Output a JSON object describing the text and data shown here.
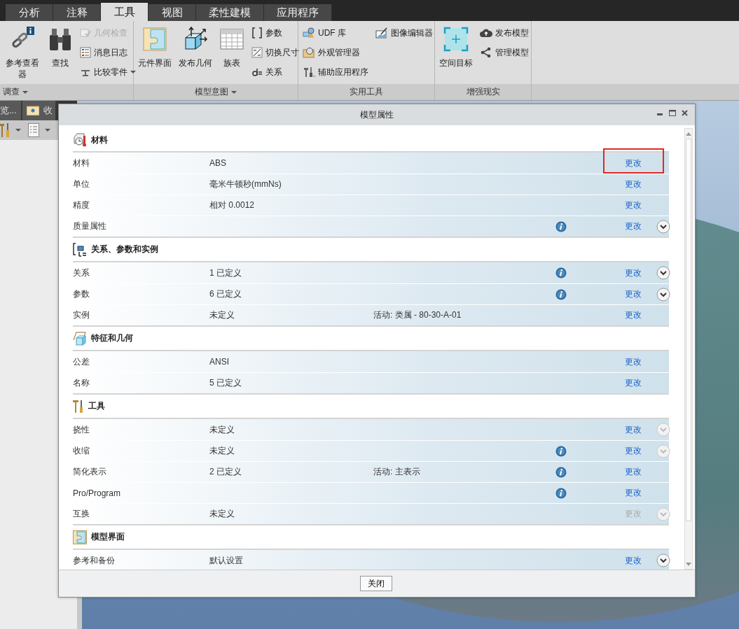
{
  "top_tabs": [
    {
      "label": "分析",
      "selected": false
    },
    {
      "label": "注释",
      "selected": false
    },
    {
      "label": "工具",
      "selected": true
    },
    {
      "label": "视图",
      "selected": false
    },
    {
      "label": "柔性建模",
      "selected": false
    },
    {
      "label": "应用程序",
      "selected": false
    }
  ],
  "ribbon": {
    "groups": [
      {
        "label": "调查",
        "dropdown": true,
        "items": [
          {
            "kind": "large",
            "label": "参考查看器",
            "disabled": false,
            "dropdown": false
          },
          {
            "kind": "large",
            "label": "查找",
            "disabled": false,
            "dropdown": false
          },
          {
            "kind": "small",
            "label": "几何检查",
            "disabled": true,
            "dropdown": false
          },
          {
            "kind": "small",
            "label": "消息日志",
            "disabled": false,
            "dropdown": false
          },
          {
            "kind": "small",
            "label": "比较零件",
            "disabled": false,
            "dropdown": true
          }
        ]
      },
      {
        "label": "模型意图",
        "dropdown": true,
        "items": [
          {
            "kind": "large",
            "label": "元件界面",
            "disabled": false,
            "dropdown": false
          },
          {
            "kind": "large",
            "label": "发布几何",
            "disabled": false,
            "dropdown": false
          },
          {
            "kind": "large",
            "label": "族表",
            "disabled": false,
            "dropdown": false
          },
          {
            "kind": "small",
            "label": "参数",
            "disabled": false,
            "dropdown": false
          },
          {
            "kind": "small",
            "label": "切换尺寸",
            "disabled": false,
            "dropdown": false
          },
          {
            "kind": "small",
            "label": "关系",
            "disabled": false,
            "dropdown": false
          }
        ]
      },
      {
        "label": "实用工具",
        "dropdown": false,
        "items": [
          {
            "kind": "small",
            "label": "UDF 库",
            "disabled": false,
            "dropdown": false
          },
          {
            "kind": "small",
            "label": "外观管理器",
            "disabled": false,
            "dropdown": false
          },
          {
            "kind": "small",
            "label": "辅助应用程序",
            "disabled": false,
            "dropdown": false
          },
          {
            "kind": "small",
            "label": "图像编辑器",
            "disabled": false,
            "dropdown": false
          }
        ]
      },
      {
        "label": "增强现实",
        "dropdown": false,
        "items": [
          {
            "kind": "large",
            "label": "空间目标",
            "disabled": false,
            "dropdown": false
          },
          {
            "kind": "small",
            "label": "发布模型",
            "disabled": false,
            "dropdown": false
          },
          {
            "kind": "small",
            "label": "管理模型",
            "disabled": false,
            "dropdown": false
          }
        ]
      }
    ]
  },
  "side_panel": {
    "tabs": [
      {
        "label": "览..."
      },
      {
        "label": "收"
      }
    ]
  },
  "dialog": {
    "title": "模型属性",
    "sections": [
      {
        "title": "材料",
        "rows": [
          {
            "label": "材料",
            "value": "ABS",
            "extra": "",
            "info": false,
            "link": "更改",
            "link_disabled": false,
            "expander": false,
            "highlighted": true
          },
          {
            "label": "单位",
            "value": "毫米牛顿秒(mmNs)",
            "extra": "",
            "info": false,
            "link": "更改",
            "link_disabled": false,
            "expander": false,
            "highlighted": false
          },
          {
            "label": "精度",
            "value": "相对 0.0012",
            "extra": "",
            "info": false,
            "link": "更改",
            "link_disabled": false,
            "expander": false,
            "highlighted": false
          },
          {
            "label": "质量属性",
            "value": "",
            "extra": "",
            "info": true,
            "link": "更改",
            "link_disabled": false,
            "expander": true,
            "expander_disabled": false,
            "highlighted": false
          }
        ]
      },
      {
        "title": "关系、参数和实例",
        "rows": [
          {
            "label": "关系",
            "value": "1 已定义",
            "extra": "",
            "info": true,
            "link": "更改",
            "link_disabled": false,
            "expander": true,
            "expander_disabled": false,
            "highlighted": false
          },
          {
            "label": "参数",
            "value": "6 已定义",
            "extra": "",
            "info": true,
            "link": "更改",
            "link_disabled": false,
            "expander": true,
            "expander_disabled": false,
            "highlighted": false
          },
          {
            "label": "实例",
            "value": "未定义",
            "extra": "活动: 类属 - 80-30-A-01",
            "info": false,
            "link": "更改",
            "link_disabled": false,
            "expander": false,
            "highlighted": false
          }
        ]
      },
      {
        "title": "特征和几何",
        "rows": [
          {
            "label": "公差",
            "value": "ANSI",
            "extra": "",
            "info": false,
            "link": "更改",
            "link_disabled": false,
            "expander": false,
            "highlighted": false
          },
          {
            "label": "名称",
            "value": "5 已定义",
            "extra": "",
            "info": false,
            "link": "更改",
            "link_disabled": false,
            "expander": false,
            "highlighted": false
          }
        ]
      },
      {
        "title": "工具",
        "rows": [
          {
            "label": "挠性",
            "value": "未定义",
            "extra": "",
            "info": false,
            "link": "更改",
            "link_disabled": false,
            "expander": true,
            "expander_disabled": true,
            "highlighted": false
          },
          {
            "label": "收缩",
            "value": "未定义",
            "extra": "",
            "info": true,
            "link": "更改",
            "link_disabled": false,
            "expander": true,
            "expander_disabled": true,
            "highlighted": false
          },
          {
            "label": "简化表示",
            "value": "2 已定义",
            "extra": "活动: 主表示",
            "info": true,
            "link": "更改",
            "link_disabled": false,
            "expander": false,
            "highlighted": false
          },
          {
            "label": "Pro/Program",
            "value": "",
            "extra": "",
            "info": true,
            "link": "更改",
            "link_disabled": false,
            "expander": false,
            "highlighted": false
          },
          {
            "label": "互换",
            "value": "未定义",
            "extra": "",
            "info": false,
            "link": "更改",
            "link_disabled": true,
            "expander": true,
            "expander_disabled": true,
            "highlighted": false
          }
        ]
      },
      {
        "title": "模型界面",
        "rows": [
          {
            "label": "参考和备份",
            "value": "默认设置",
            "extra": "",
            "info": false,
            "link": "更改",
            "link_disabled": false,
            "expander": true,
            "expander_disabled": false,
            "highlighted": false
          }
        ]
      }
    ],
    "close_button": "关闭"
  }
}
